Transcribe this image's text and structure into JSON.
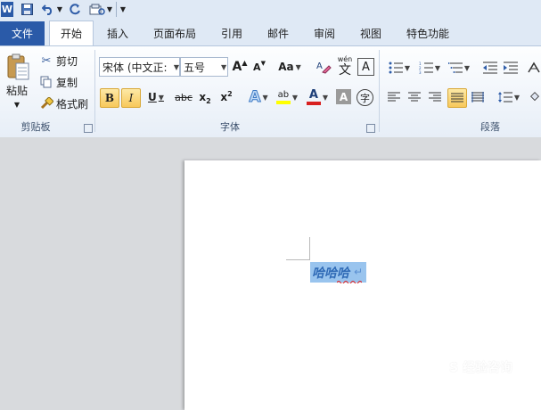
{
  "quick_access": {
    "app_icon_letter": "W",
    "items": [
      "save",
      "undo",
      "redo",
      "customize"
    ]
  },
  "tabs": {
    "file": "文件",
    "items": [
      "开始",
      "插入",
      "页面布局",
      "引用",
      "邮件",
      "审阅",
      "视图",
      "特色功能"
    ],
    "active": "开始"
  },
  "clipboard": {
    "paste": "粘贴",
    "cut": "剪切",
    "copy": "复制",
    "format_painter": "格式刷",
    "group_label": "剪贴板"
  },
  "font": {
    "font_name": "宋体 (中文正:",
    "font_size": "五号",
    "grow_label": "A",
    "shrink_label": "A",
    "change_case_label": "Aa",
    "bold": "B",
    "italic": "I",
    "underline": "U",
    "strikethrough": "abc",
    "subscript": "x",
    "superscript": "x",
    "font_color_label": "A",
    "char_shading_label": "A",
    "enclose_label": "字",
    "phonetic_label": "wén",
    "phonetic_char": "文",
    "group_label": "字体"
  },
  "paragraph": {
    "group_label": "段落"
  },
  "document": {
    "selected_text": "哈哈哈",
    "paragraph_mark": "↵"
  },
  "watermark": "S 经验咨询",
  "colors": {
    "accent": "#2a5aa8",
    "selection": "#99c4ee",
    "text_highlight": "#ffff00",
    "font_color": "#d82020"
  }
}
